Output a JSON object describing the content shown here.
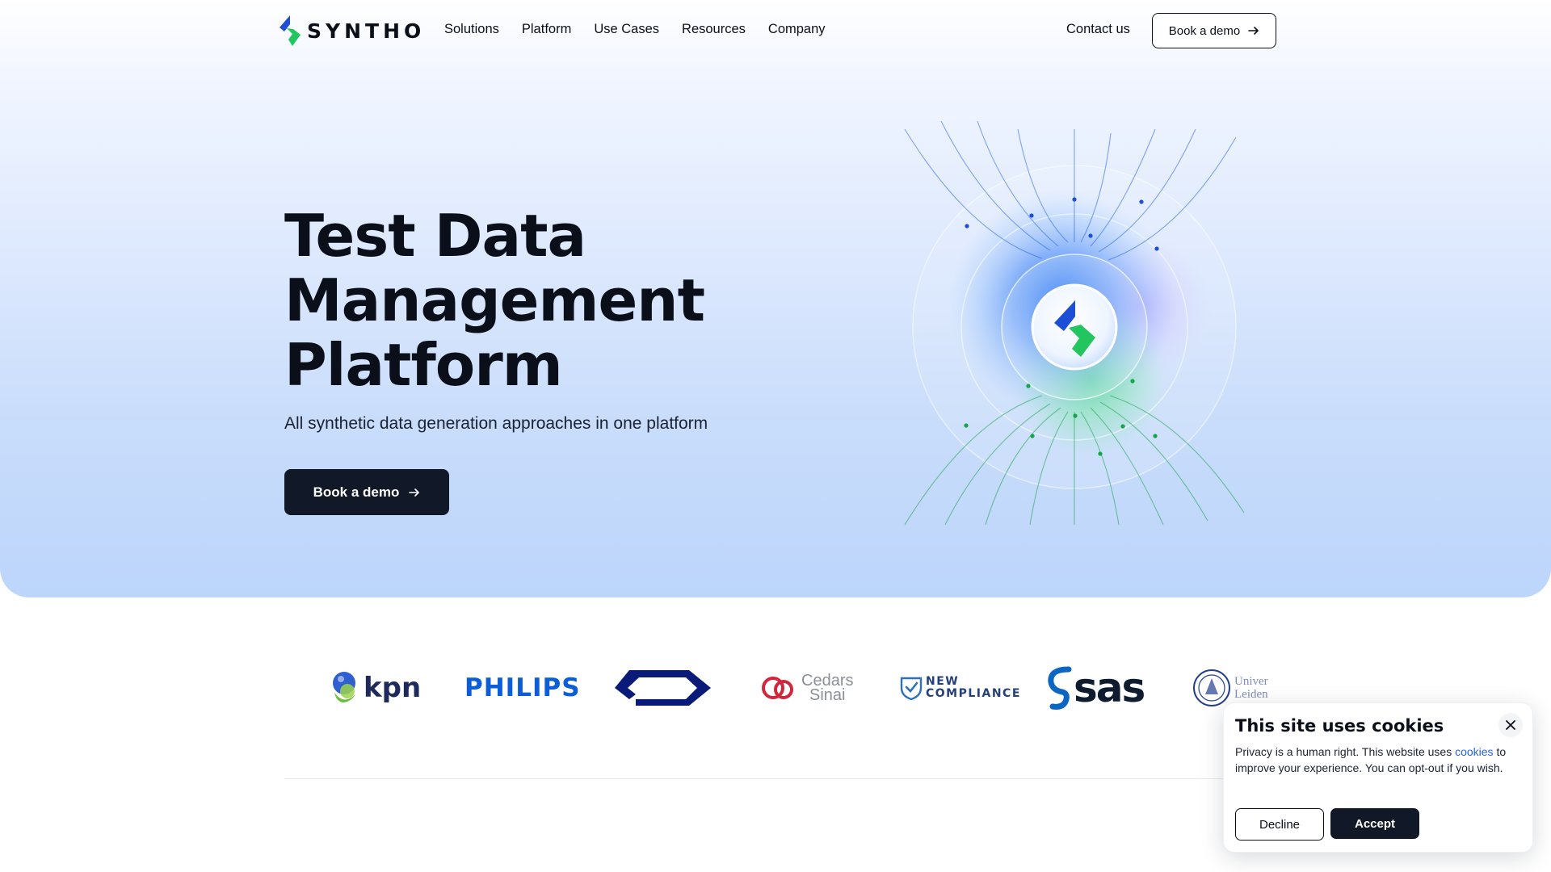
{
  "brand": {
    "name": "SYNTHO",
    "colors": {
      "blue": "#2563eb",
      "green": "#22c55e",
      "dark": "#111827"
    }
  },
  "nav": {
    "links": [
      "Solutions",
      "Platform",
      "Use Cases",
      "Resources",
      "Company"
    ],
    "contact_label": "Contact us",
    "demo_label": "Book a demo"
  },
  "hero": {
    "title_lines": [
      "Test Data",
      "Management",
      "Platform"
    ],
    "subtitle": "All synthetic data generation approaches in one platform",
    "cta_label": "Book a demo"
  },
  "clients": {
    "kpn": "kpn",
    "philips": "PHILIPS",
    "ns": "NS",
    "cedars_line1": "Cedars",
    "cedars_line2": "Sinai",
    "newcomp_line1": "NEW",
    "newcomp_line2": "COMPLIANCE",
    "sas": "sas",
    "leiden_line1": "Univer",
    "leiden_line2": "Leiden"
  },
  "cookie": {
    "title": "This site uses cookies",
    "text_before": "Privacy is a human right. This website uses",
    "link": "cookies",
    "text_after": "to improve your experience. You can opt-out if you wish.",
    "decline_label": "Decline",
    "accept_label": "Accept"
  },
  "icons": {
    "arrow": "arrow-right-icon",
    "close": "close-icon"
  }
}
